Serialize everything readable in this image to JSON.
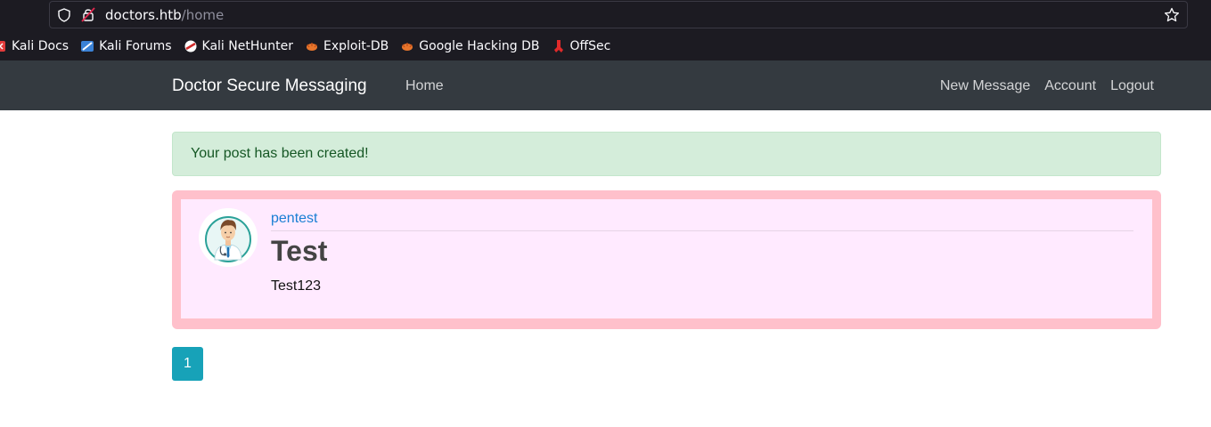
{
  "browser": {
    "url_host": "doctors.htb",
    "url_path": "/home",
    "bookmarks": [
      {
        "label": "Kali Docs",
        "icon": "kali-docs-icon"
      },
      {
        "label": "Kali Forums",
        "icon": "kali-forums-icon"
      },
      {
        "label": "Kali NetHunter",
        "icon": "kali-nethunter-icon"
      },
      {
        "label": "Exploit-DB",
        "icon": "exploit-db-icon"
      },
      {
        "label": "Google Hacking DB",
        "icon": "google-hacking-db-icon"
      },
      {
        "label": "OffSec",
        "icon": "offsec-icon"
      }
    ]
  },
  "navbar": {
    "brand": "Doctor Secure Messaging",
    "home": "Home",
    "new_message": "New Message",
    "account": "Account",
    "logout": "Logout"
  },
  "flash": {
    "message": "Your post has been created!"
  },
  "post": {
    "author": "pentest",
    "title": "Test",
    "content": "Test123",
    "avatar_icon": "doctor-avatar-icon"
  },
  "pagination": {
    "current_page": "1"
  },
  "colors": {
    "navbar_bg": "#343a40",
    "alert_bg": "#d4edda",
    "post_border": "#ffc0cb",
    "post_bg": "#ffeaff",
    "page_btn": "#17a2b8"
  }
}
